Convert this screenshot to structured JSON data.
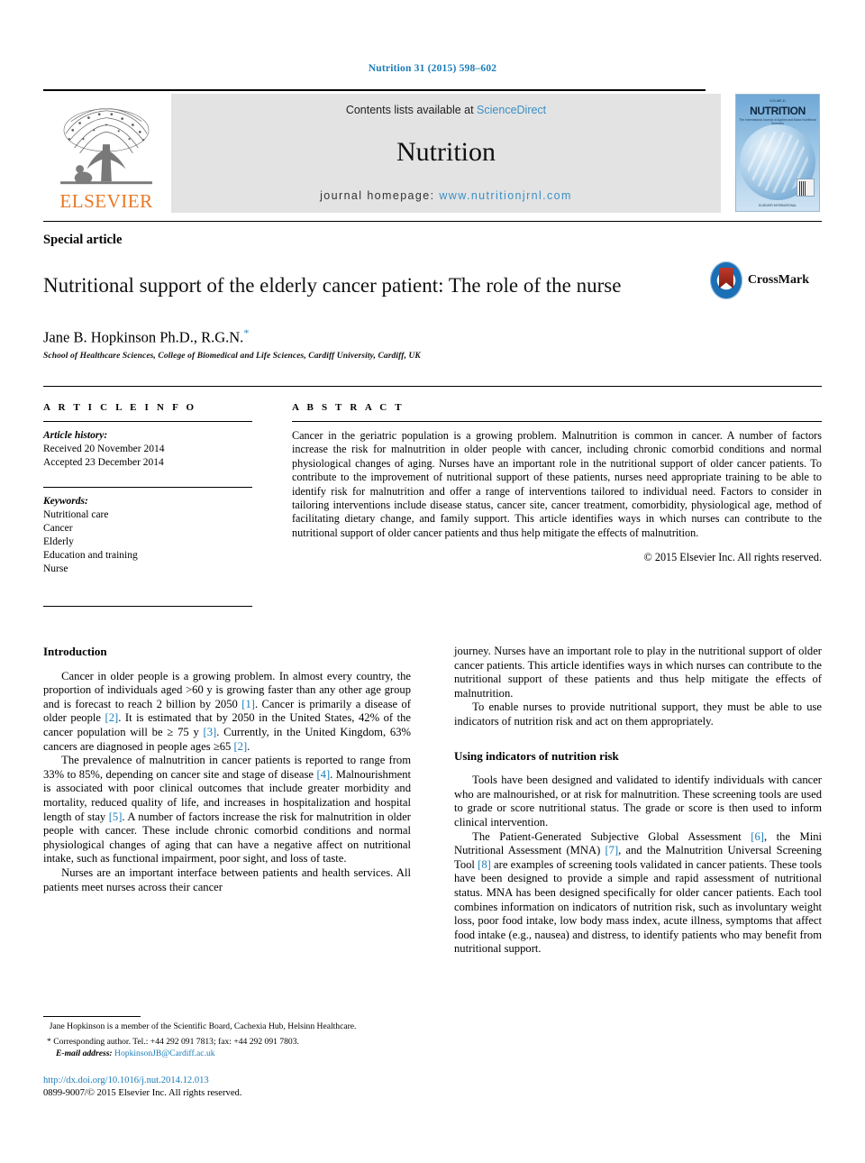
{
  "running_head": "Nutrition 31 (2015) 598–602",
  "masthead": {
    "publisher": "ELSEVIER",
    "contents_prefix": "Contents lists available at ",
    "contents_link": "ScienceDirect",
    "journal_title": "Nutrition",
    "homepage_label": "journal homepage: ",
    "homepage_url": "www.nutritionjrnl.com",
    "cover": {
      "top_line": "VOLUME 31",
      "name": "NUTRITION",
      "subtitle": "The International Journal of Applied and Basic Nutritional Sciences",
      "footer": "ELSEVIER INTERNATIONAL"
    }
  },
  "article": {
    "type_label": "Special article",
    "title": "Nutritional support of the elderly cancer patient: The role of the nurse",
    "authors": "Jane B. Hopkinson Ph.D., R.G.N.",
    "author_marker": "*",
    "affiliation": "School of Healthcare Sciences, College of Biomedical and Life Sciences, Cardiff University, Cardiff, UK",
    "crossmark_label": "CrossMark"
  },
  "article_info": {
    "heading": "A R T I C L E   I N F O",
    "history_label": "Article history:",
    "history": [
      "Received 20 November 2014",
      "Accepted 23 December 2014"
    ],
    "keywords_label": "Keywords:",
    "keywords": [
      "Nutritional care",
      "Cancer",
      "Elderly",
      "Education and training",
      "Nurse"
    ]
  },
  "abstract": {
    "heading": "A B S T R A C T",
    "text": "Cancer in the geriatric population is a growing problem. Malnutrition is common in cancer. A number of factors increase the risk for malnutrition in older people with cancer, including chronic comorbid conditions and normal physiological changes of aging. Nurses have an important role in the nutritional support of older cancer patients. To contribute to the improvement of nutritional support of these patients, nurses need appropriate training to be able to identify risk for malnutrition and offer a range of interventions tailored to individual need. Factors to consider in tailoring interventions include disease status, cancer site, cancer treatment, comorbidity, physiological age, method of facilitating dietary change, and family support. This article identifies ways in which nurses can contribute to the nutritional support of older cancer patients and thus help mitigate the effects of malnutrition.",
    "copyright": "© 2015 Elsevier Inc. All rights reserved."
  },
  "body": {
    "left": {
      "section_heading": "Introduction",
      "paragraph_1_a": "Cancer in older people is a growing problem. In almost every country, the proportion of individuals aged >60 y is growing faster than any other age group and is forecast to reach 2 billion by 2050 ",
      "ref1": "[1]",
      "paragraph_1_b": ". Cancer is primarily a disease of older people ",
      "ref2": "[2]",
      "paragraph_1_c": ". It is estimated that by 2050 in the United States, 42% of the cancer population will be ≥ 75 y ",
      "ref3": "[3]",
      "paragraph_1_d": ". Currently, in the United Kingdom, 63% cancers are diagnosed in people ages ≥65 ",
      "ref4": "[2]",
      "paragraph_1_e": ".",
      "paragraph_2_a": "The prevalence of malnutrition in cancer patients is reported to range from 33% to 85%, depending on cancer site and stage of disease ",
      "ref5": "[4]",
      "paragraph_2_b": ". Malnourishment is associated with poor clinical outcomes that include greater morbidity and mortality, reduced quality of life, and increases in hospitalization and hospital length of stay ",
      "ref6": "[5]",
      "paragraph_2_c": ". A number of factors increase the risk for malnutrition in older people with cancer. These include chronic comorbid conditions and normal physiological changes of aging that can have a negative affect on nutritional intake, such as functional impairment, poor sight, and loss of taste.",
      "paragraph_3": "Nurses are an important interface between patients and health services. All patients meet nurses across their cancer"
    },
    "right": {
      "paragraph_1": "journey. Nurses have an important role to play in the nutritional support of older cancer patients. This article identifies ways in which nurses can contribute to the nutritional support of these patients and thus help mitigate the effects of malnutrition.",
      "paragraph_2": "To enable nurses to provide nutritional support, they must be able to use indicators of nutrition risk and act on them appropriately.",
      "section_heading": "Using indicators of nutrition risk",
      "paragraph_3": "Tools have been designed and validated to identify individuals with cancer who are malnourished, or at risk for malnutrition. These screening tools are used to grade or score nutritional status. The grade or score is then used to inform clinical intervention.",
      "paragraph_4_a": "The Patient-Generated Subjective Global Assessment ",
      "ref6": "[6]",
      "paragraph_4_b": ", the Mini Nutritional Assessment (MNA) ",
      "ref7": "[7]",
      "paragraph_4_c": ", and the Malnutrition Universal Screening Tool ",
      "ref8": "[8]",
      "paragraph_4_d": " are examples of screening tools validated in cancer patients. These tools have been designed to provide a simple and rapid assessment of nutritional status. MNA has been designed specifically for older cancer patients. Each tool combines information on indicators of nutrition risk, such as involuntary weight loss, poor food intake, low body mass index, acute illness, symptoms that affect food intake (e.g., nausea) and distress, to identify patients who may benefit from nutritional support."
    }
  },
  "footnotes": {
    "note_1": "Jane Hopkinson is a member of the Scientific Board, Cachexia Hub, Helsinn Healthcare.",
    "note_2_marker": "*",
    "note_2": " Corresponding author. Tel.: +44 292 091 7813; fax: +44 292 091 7803.",
    "email_label": "E-mail address:",
    "email": "HopkinsonJB@Cardiff.ac.uk",
    "doi": "http://dx.doi.org/10.1016/j.nut.2014.12.013",
    "issn_line": "0899-9007/© 2015 Elsevier Inc. All rights reserved."
  },
  "colors": {
    "link": "#1a7cb8",
    "elsevier_orange": "#E87722",
    "banner_grey": "#e3e3e3"
  }
}
